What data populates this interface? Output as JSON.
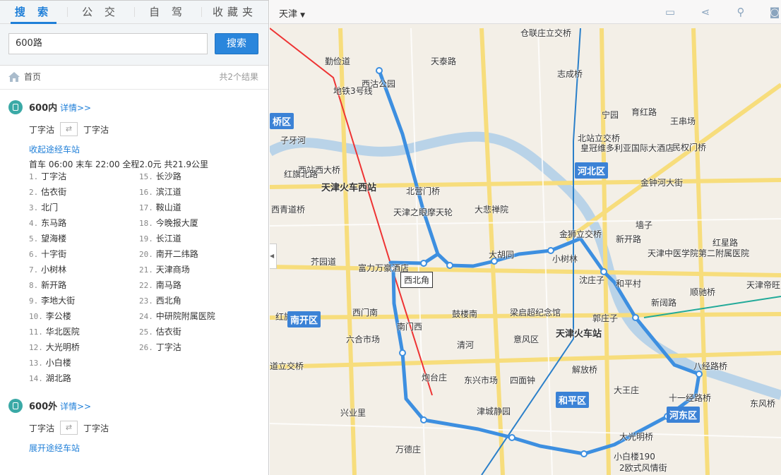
{
  "tabs": [
    "搜 索",
    "公 交",
    "自 驾",
    "收藏夹"
  ],
  "search": {
    "value": "600路",
    "button": "搜索"
  },
  "breadcrumb": {
    "home": "首页",
    "count": "共2个结果"
  },
  "results": [
    {
      "name": "600内",
      "detail": "详情>>",
      "from": "丁字沽",
      "to": "丁字沽",
      "toggle": "收起途经车站",
      "info": "首车 06:00 末车 22:00 全程2.0元 共21.9公里",
      "stops": [
        "丁字沽",
        "估衣街",
        "北门",
        "东马路",
        "望海楼",
        "十字街",
        "小树林",
        "新开路",
        "李地大街",
        "李公楼",
        "华北医院",
        "大光明桥",
        "小白楼",
        "湖北路",
        "长沙路",
        "滨江道",
        "鞍山道",
        "今晚报大厦",
        "长江道",
        "南开二纬路",
        "天津商场",
        "南马路",
        "西北角",
        "中研院附属医院",
        "估衣街",
        "丁字沽"
      ]
    },
    {
      "name": "600外",
      "detail": "详情>>",
      "from": "丁字沽",
      "to": "丁字沽",
      "toggle": "展开途经车站"
    }
  ],
  "map": {
    "city": "天津",
    "callout": "西北角",
    "districts": [
      "河北区",
      "南开区",
      "和平区",
      "河东区",
      "桥区"
    ],
    "labels": [
      "仓联庄立交桥",
      "志成桥",
      "宁园",
      "北站立交桥",
      "育红路",
      "民权门桥",
      "王串场",
      "皇冠维多利亚国际大酒店",
      "西沽公园",
      "天泰路",
      "勤俭道",
      "地铁3号线",
      "西站西大桥",
      "天津火车西站",
      "北营门桥",
      "天津之眼摩天轮",
      "大悲禅院",
      "西青道桥",
      "红旗北路",
      "芥园道",
      "富力万豪酒店",
      "大胡同",
      "小树林",
      "金狮立交桥",
      "墙子",
      "天津中医学院第二附属医院",
      "红星路",
      "沈庄子",
      "和平村",
      "顺驰桥",
      "天津帝旺凯悦酒店",
      "西门南",
      "鼓楼南",
      "梁启超纪念馆",
      "郭庄子",
      "天津火车站",
      "南门西",
      "意风区",
      "六合市场",
      "清河",
      "道立交桥",
      "解放桥",
      "炮台庄",
      "东兴市场",
      "四面钟",
      "大王庄",
      "十一经路桥",
      "东风桥",
      "津城静园",
      "兴业里",
      "大光明桥",
      "万德庄",
      "小白楼190",
      "2欧式风情街",
      "红旗路",
      "子牙河",
      "金钟河大街",
      "新开路",
      "八经路桥",
      "新阔路"
    ],
    "route_color": "#3d8fe0"
  }
}
